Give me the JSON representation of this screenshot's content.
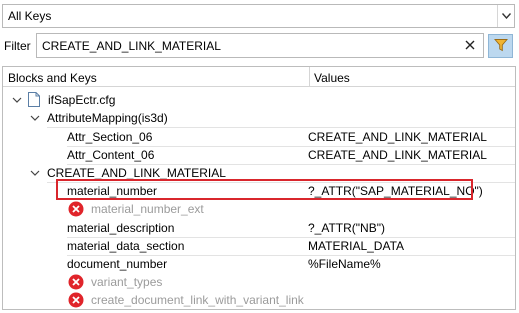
{
  "dropdown": {
    "value": "All Keys"
  },
  "filter": {
    "label": "Filter",
    "value": "CREATE_AND_LINK_MATERIAL"
  },
  "tree": {
    "headers": {
      "keys": "Blocks and Keys",
      "values": "Values"
    },
    "file": "ifSapEctr.cfg",
    "mapping_block": "AttributeMapping(is3d)",
    "mapping_rows": [
      {
        "key": "Attr_Section_06",
        "value": "CREATE_AND_LINK_MATERIAL"
      },
      {
        "key": "Attr_Content_06",
        "value": "CREATE_AND_LINK_MATERIAL"
      }
    ],
    "create_block": "CREATE_AND_LINK_MATERIAL",
    "create_rows": [
      {
        "key": "material_number",
        "value": "?_ATTR(\"SAP_MATERIAL_NO\")"
      },
      {
        "key": "material_number_ext",
        "value": ""
      },
      {
        "key": "material_description",
        "value": "?_ATTR(\"NB\")"
      },
      {
        "key": "material_data_section",
        "value": "MATERIAL_DATA"
      },
      {
        "key": "document_number",
        "value": "%FileName%"
      },
      {
        "key": "variant_types",
        "value": ""
      },
      {
        "key": "create_document_link_with_variant_link",
        "value": ""
      }
    ]
  },
  "colors": {
    "highlight": "#d9262c",
    "error": "#e0242a",
    "filter_button": "#bcd8ef"
  }
}
